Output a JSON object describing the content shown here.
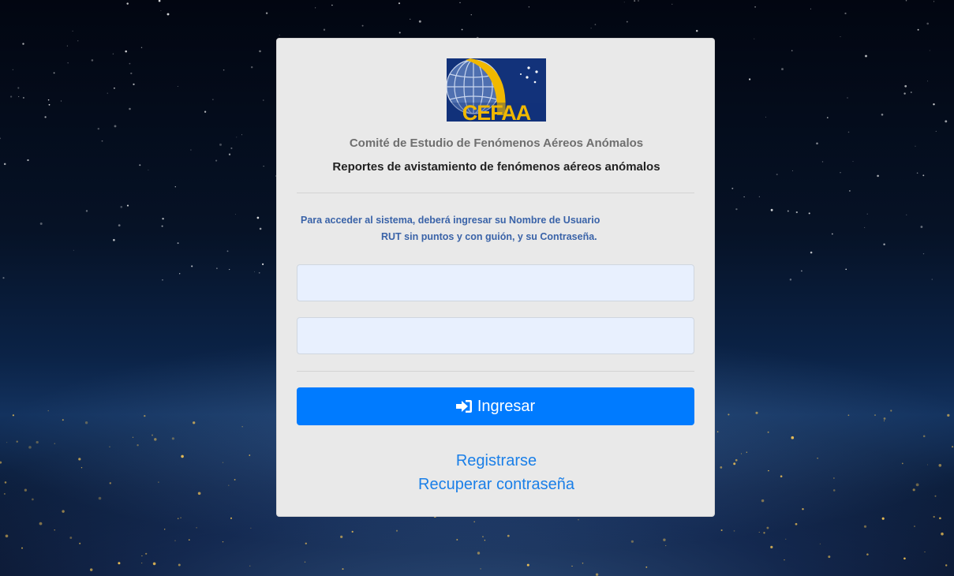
{
  "page": {
    "title": "CEFAA - Reportes de avistamiento"
  },
  "logo": {
    "text": "CEFAA",
    "colors": {
      "blue": "#12327a",
      "gold": "#f0b800"
    }
  },
  "header": {
    "org_name": "Comité de Estudio de Fenómenos Aéreos Anómalos",
    "subtitle": "Reportes de avistamiento de fenómenos aéreos anómalos"
  },
  "instructions": {
    "line1": "Para acceder al sistema, deberá ingresar su Nombre de Usuario",
    "line2": "RUT sin puntos y con guión, y su Contraseña."
  },
  "form": {
    "username_value": "",
    "password_value": "",
    "submit_label": "Ingresar",
    "submit_icon": "sign-in-icon"
  },
  "links": {
    "register": "Registrarse",
    "recover": "Recuperar contraseña"
  },
  "colors": {
    "primary": "#007bff",
    "link": "#1a7fe8",
    "instructions": "#3a63a8",
    "input_bg": "#e8f0fe"
  }
}
